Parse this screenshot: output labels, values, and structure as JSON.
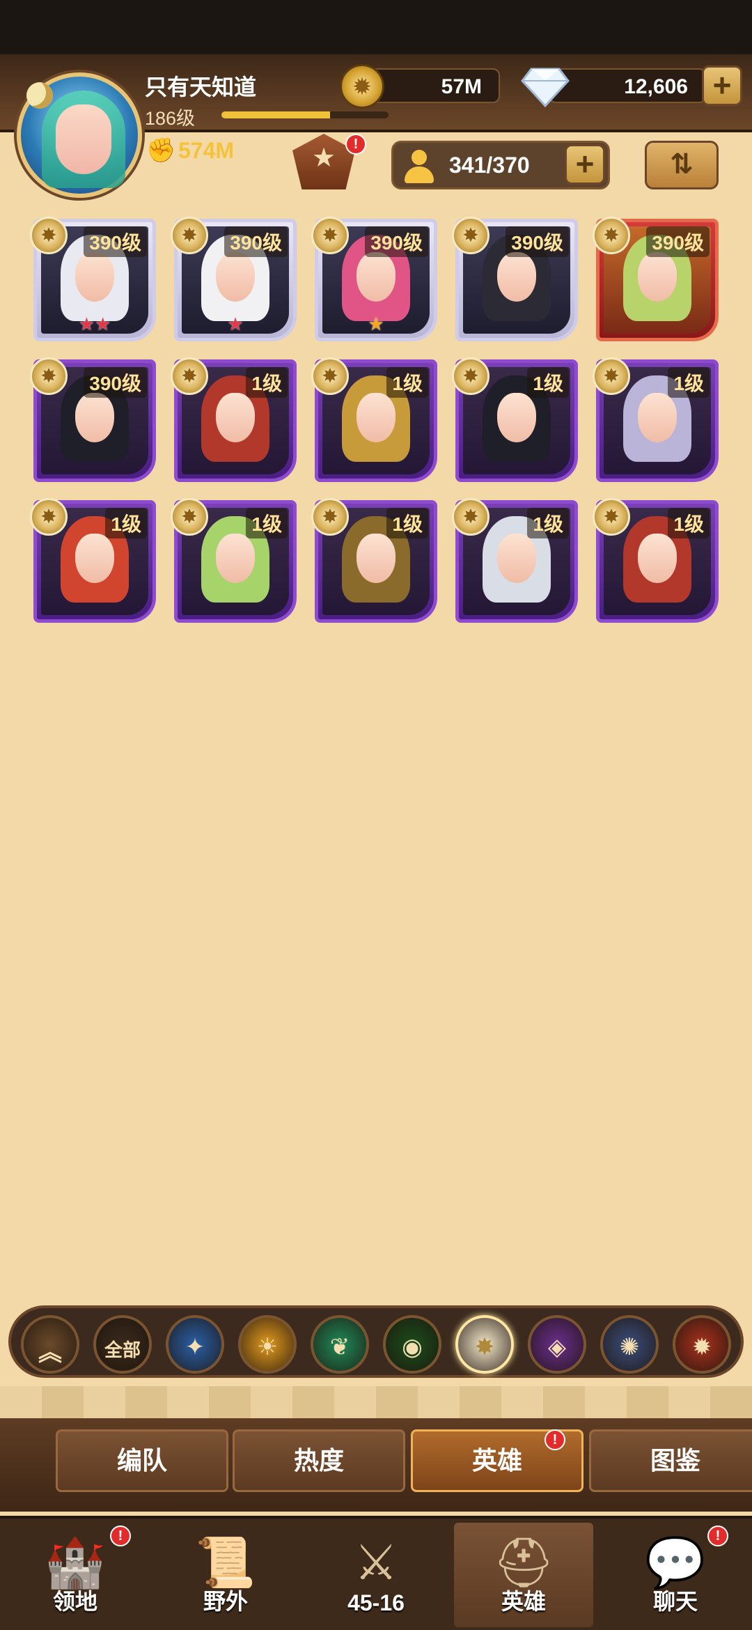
{
  "player": {
    "name": "只有天知道",
    "level": "186级",
    "xp_fraction": 0.65,
    "power": "574M"
  },
  "resources": {
    "gold": "57M",
    "diamonds": "12,606"
  },
  "roster": {
    "count": "341/370"
  },
  "heroes": [
    {
      "level": "390级",
      "frame": "silver",
      "stars": "★★",
      "star_color": "red",
      "hair": "#e9e9f2"
    },
    {
      "level": "390级",
      "frame": "silver",
      "stars": "★",
      "star_color": "red",
      "hair": "#f1f1f4"
    },
    {
      "level": "390级",
      "frame": "silver",
      "stars": "★",
      "star_color": "gold",
      "hair": "#e05585"
    },
    {
      "level": "390级",
      "frame": "silver",
      "stars": "",
      "star_color": "red",
      "hair": "#2b2a35"
    },
    {
      "level": "390级",
      "frame": "red",
      "stars": "",
      "star_color": "red",
      "hair": "#b7d36a"
    },
    {
      "level": "390级",
      "frame": "purple",
      "stars": "",
      "star_color": "red",
      "hair": "#1e1f29"
    },
    {
      "level": "1级",
      "frame": "purple",
      "stars": "",
      "star_color": "red",
      "hair": "#b1382a"
    },
    {
      "level": "1级",
      "frame": "purple",
      "stars": "",
      "star_color": "red",
      "hair": "#c79a3a"
    },
    {
      "level": "1级",
      "frame": "purple",
      "stars": "",
      "star_color": "red",
      "hair": "#1e1f29"
    },
    {
      "level": "1级",
      "frame": "purple",
      "stars": "",
      "star_color": "red",
      "hair": "#b9b4d8"
    },
    {
      "level": "1级",
      "frame": "purple",
      "stars": "",
      "star_color": "red",
      "hair": "#d1452e"
    },
    {
      "level": "1级",
      "frame": "purple",
      "stars": "",
      "star_color": "red",
      "hair": "#a6d36a"
    },
    {
      "level": "1级",
      "frame": "purple",
      "stars": "",
      "star_color": "red",
      "hair": "#8a6b2c"
    },
    {
      "level": "1级",
      "frame": "purple",
      "stars": "",
      "star_color": "red",
      "hair": "#d9dde5"
    },
    {
      "level": "1级",
      "frame": "purple",
      "stars": "",
      "star_color": "red",
      "hair": "#b1382a"
    }
  ],
  "factions": {
    "all_label": "全部",
    "selected_index": 6,
    "items": [
      {
        "name": "collapse-icon",
        "color": "#6b4a2a"
      },
      {
        "name": "all",
        "color": "#3a2a1c"
      },
      {
        "name": "lightbearers-icon",
        "color": "#2a5fa6"
      },
      {
        "name": "mauler-icon",
        "color": "#e39a1e"
      },
      {
        "name": "wilder-icon",
        "color": "#1f8a58"
      },
      {
        "name": "graveborn-icon",
        "color": "#1c4d1c"
      },
      {
        "name": "celestial-icon",
        "color": "#f4e7c9"
      },
      {
        "name": "hypogean-icon",
        "color": "#6a2e8c"
      },
      {
        "name": "dimensional-icon",
        "color": "#3b4d7a"
      },
      {
        "name": "dragon-icon",
        "color": "#a8321e"
      }
    ]
  },
  "subtabs": [
    "编队",
    "热度",
    "英雄",
    "图鉴"
  ],
  "bottom_nav": [
    "领地",
    "野外",
    "45-16",
    "英雄",
    "聊天"
  ],
  "colors": {
    "accent_gold": "#f0c23a",
    "badge_red": "#e22c2c",
    "background": "#f3d9a8"
  }
}
